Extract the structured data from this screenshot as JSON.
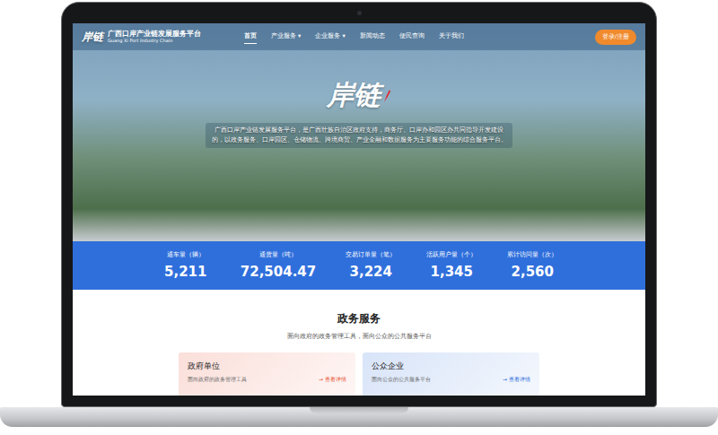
{
  "header": {
    "logo": "岸链",
    "title": "广西口岸产业链发展服务平台",
    "subtitle": "Guang Xi Port Industry Chain",
    "caret": "▾",
    "nav": [
      {
        "label": "首页",
        "selected": true,
        "dropdown": false
      },
      {
        "label": "产业服务",
        "selected": false,
        "dropdown": true
      },
      {
        "label": "企业服务",
        "selected": false,
        "dropdown": true
      },
      {
        "label": "新闻动态",
        "selected": false,
        "dropdown": false
      },
      {
        "label": "便民查询",
        "selected": false,
        "dropdown": false
      },
      {
        "label": "关于我们",
        "selected": false,
        "dropdown": false
      }
    ],
    "login": "登录/注册"
  },
  "hero": {
    "logo": "岸链",
    "intro": "广西口岸产业链发展服务平台，是广西壮族自治区政府支持，商务厅、口岸办和园区办共同指导开发建设的，以政务服务、口岸园区、仓储物流、跨境商贸、产业金融和数据服务为主要服务功能的综合服务平台。"
  },
  "stats": [
    {
      "label": "通车量（辆）",
      "value": "5,211"
    },
    {
      "label": "通货量（吨）",
      "value": "72,504.47"
    },
    {
      "label": "交易订单量（笔）",
      "value": "3,224"
    },
    {
      "label": "活跃用户量（个）",
      "value": "1,345"
    },
    {
      "label": "累计访问量（次）",
      "value": "2,560"
    }
  ],
  "section": {
    "title": "政务服务",
    "subtitle": "面向政府的政务管理工具，面向公众的公共服务平台",
    "cards": [
      {
        "title": "政府单位",
        "desc": "面向政府的政务管理工具",
        "arrow": "→",
        "link": "查看详情",
        "color": "#e8553a"
      },
      {
        "title": "公众企业",
        "desc": "面向公众的公共服务平台",
        "arrow": "→",
        "link": "查看详情",
        "color": "#2f6fdc"
      }
    ]
  }
}
